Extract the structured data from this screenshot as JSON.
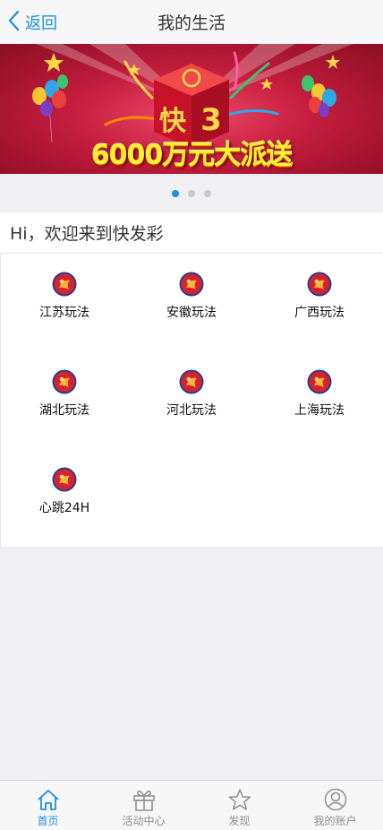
{
  "navbar": {
    "back_label": "返回",
    "title": "我的生活"
  },
  "banner": {
    "text": "6000万元大派送",
    "badge_char": "快",
    "badge_number": "3"
  },
  "carousel": {
    "active_index": 0,
    "count": 3
  },
  "welcome": {
    "text": "Hi，欢迎来到快发彩"
  },
  "games": [
    {
      "label": "江苏玩法"
    },
    {
      "label": "安徽玩法"
    },
    {
      "label": "广西玩法"
    },
    {
      "label": "湖北玩法"
    },
    {
      "label": "河北玩法"
    },
    {
      "label": "上海玩法"
    },
    {
      "label": "心跳24H"
    }
  ],
  "tabbar": {
    "items": [
      {
        "label": "首页",
        "icon": "home-icon",
        "active": true
      },
      {
        "label": "活动中心",
        "icon": "gift-icon",
        "active": false
      },
      {
        "label": "发现",
        "icon": "star-icon",
        "active": false
      },
      {
        "label": "我的账户",
        "icon": "user-icon",
        "active": false
      }
    ]
  },
  "colors": {
    "accent": "#1a8fe3",
    "banner_red": "#c41d3e",
    "banner_text": "#ffef2e",
    "inactive": "#8e8e93"
  }
}
